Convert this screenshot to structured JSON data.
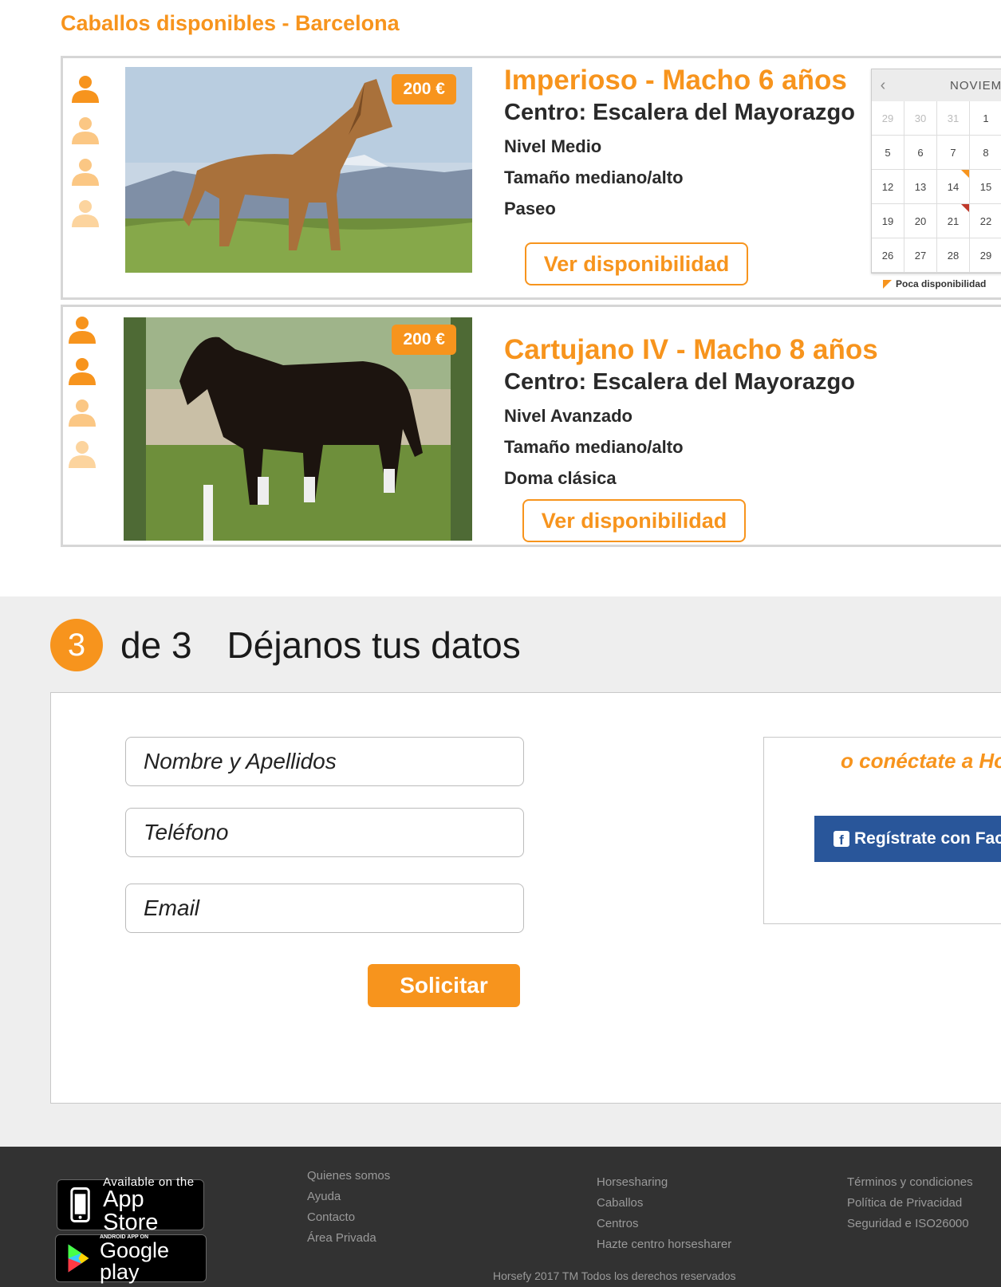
{
  "page": {
    "title": "Caballos disponibles - Barcelona",
    "accent_color": "#f7941d"
  },
  "horses": [
    {
      "price": "200 €",
      "name": "Imperioso  - Macho 6 años",
      "center": "Centro: Escalera del Mayorazgo",
      "level": "Nivel Medio",
      "size": "Tamaño mediano/alto",
      "discipline": "Paseo",
      "availability_label": "Ver disponibilidad",
      "riders": [
        "full",
        "faded",
        "faded",
        "faded"
      ]
    },
    {
      "price": "200 €",
      "name": "Cartujano IV  - Macho 8 años",
      "center": "Centro: Escalera del Mayorazgo",
      "level": "Nivel Avanzado",
      "size": "Tamaño mediano/alto",
      "discipline": "Doma clásica",
      "availability_label": "Ver disponibilidad",
      "riders": [
        "full",
        "full",
        "faded",
        "faded"
      ]
    }
  ],
  "calendar": {
    "month": "NOVIEM",
    "prev_icon": "chevron-left-icon",
    "days": [
      {
        "d": "29",
        "state": "muted"
      },
      {
        "d": "30",
        "state": "muted"
      },
      {
        "d": "31",
        "state": "muted"
      },
      {
        "d": "1",
        "state": ""
      },
      {
        "d": "",
        "state": ""
      },
      {
        "d": "5",
        "state": ""
      },
      {
        "d": "6",
        "state": ""
      },
      {
        "d": "7",
        "state": ""
      },
      {
        "d": "8",
        "state": ""
      },
      {
        "d": "",
        "state": ""
      },
      {
        "d": "12",
        "state": ""
      },
      {
        "d": "13",
        "state": ""
      },
      {
        "d": "14",
        "state": "low"
      },
      {
        "d": "15",
        "state": ""
      },
      {
        "d": "",
        "state": ""
      },
      {
        "d": "19",
        "state": ""
      },
      {
        "d": "20",
        "state": ""
      },
      {
        "d": "21",
        "state": "none"
      },
      {
        "d": "22",
        "state": ""
      },
      {
        "d": "",
        "state": ""
      },
      {
        "d": "26",
        "state": ""
      },
      {
        "d": "27",
        "state": ""
      },
      {
        "d": "28",
        "state": ""
      },
      {
        "d": "29",
        "state": ""
      },
      {
        "d": "",
        "state": ""
      }
    ],
    "legend": "Poca disponibilidad"
  },
  "form": {
    "step_number": "3",
    "step_of": "de 3",
    "step_title": "Déjanos tus datos",
    "name_placeholder": "Nombre y Apellidos",
    "phone_placeholder": "Teléfono",
    "email_placeholder": "Email",
    "submit_label": "Solicitar",
    "social_title": "o conéctate a Ho",
    "facebook_label": "Regístrate con Fac"
  },
  "footer": {
    "appstore_small": "Available on the",
    "appstore_big": "App Store",
    "googleplay_small": "ANDROID APP ON",
    "googleplay_big": "Google play",
    "col1": [
      "Quienes somos",
      "Ayuda",
      "Contacto",
      "Área Privada"
    ],
    "col2": [
      "Horsesharing",
      "Caballos",
      "Centros",
      "Hazte centro horsesharer"
    ],
    "col3": [
      "Términos y condiciones",
      "Política de Privacidad",
      "Seguridad e ISO26000"
    ],
    "copyright": "Horsefy 2017 TM Todos los derechos reservados"
  }
}
